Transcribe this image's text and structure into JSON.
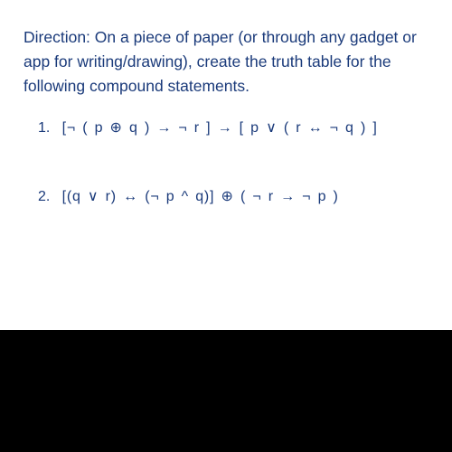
{
  "direction": "Direction: On a piece of paper (or through any gadget or app for writing/drawing), create the truth table for the following compound statements.",
  "problems": [
    {
      "num": "1.",
      "expr": "[¬ ( p ⊕ q ) → ¬ r ] → [ p ∨ ( r ↔ ¬ q ) ]"
    },
    {
      "num": "2.",
      "expr": "[(q ∨ r) ↔ (¬ p ^ q)] ⊕ ( ¬ r → ¬ p )"
    }
  ]
}
